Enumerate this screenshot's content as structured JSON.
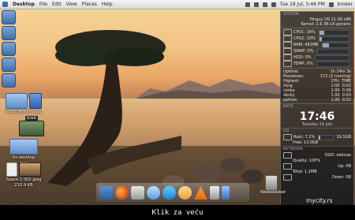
{
  "panel": {
    "app_name": "Desktop",
    "menu": [
      "File",
      "Edit",
      "View",
      "Places",
      "Help"
    ],
    "datetime": "Tue 19 Jul, 5:46 PM",
    "user": "broker"
  },
  "desktop_icons": [
    {
      "label": "IV-BBEN_form.doc",
      "kind": "word"
    },
    {
      "label": "brek",
      "kind": "photo"
    },
    {
      "label": "its-desktop",
      "kind": "folder"
    },
    {
      "label": "jpeg",
      "kind": "folder"
    },
    {
      "label": "Space 1.002.jpeg",
      "kind": "photo"
    },
    {
      "label": "210.9 KB",
      "kind": "text"
    }
  ],
  "widget": {
    "system_header": "SYSTEM",
    "distro": "Pinguy OS 11.04 x86",
    "kernel": "Kernel: 2.6.38-10-generic",
    "cpu1_label": "CPU1: 16%",
    "cpu2_label": "CPU2: 10%",
    "ram_label": "RAM: 491MB",
    "swap_label": "SWAP: 0%",
    "hdd_label": "HDD: 0%",
    "temp_label": "TEMP: 0%",
    "uptime_label": "Uptime:",
    "uptime_value": "1h 14m 3s",
    "processes_label": "Processes:",
    "processes_value": "172 (2 running)",
    "highest_label": "Highest:",
    "highest_cols": [
      "CPU",
      "TIME"
    ],
    "procs": [
      {
        "name": "Xorg",
        "cpu": "1.00",
        "time": "0:02"
      },
      {
        "name": "conky",
        "cpu": "1.00",
        "time": "0:06"
      },
      {
        "name": "docky",
        "cpu": "1.00",
        "time": "0:03"
      },
      {
        "name": "python",
        "cpu": "1.00",
        "time": "0:02"
      }
    ],
    "date_header": "DATE",
    "clock": "17:46",
    "date": "Tuesday 19 July",
    "hd_header": "HD",
    "root_label": "Root: 7.2%",
    "root_value": "19.5GB",
    "free_label": "Free: 12.0GB",
    "network_header": "NETWORK",
    "ssid_label": "SSID: edimax",
    "quality_label": "Quality: 100%",
    "up_label": "Up: 0B",
    "total_label": "Total: 1.1MB",
    "down_label": "Down: 0B"
  },
  "dock": {
    "items": [
      "download-icon",
      "firefox-icon",
      "shutter-icon",
      "pidgin-icon",
      "skype-icon",
      "network-icon",
      "vlc-icon",
      "disk-icon",
      "usb-icon",
      "wastebasket-icon"
    ],
    "wastebasket_label": "Wastebasket"
  },
  "watermark": "mycity.rs",
  "caption": "Klik za veću"
}
